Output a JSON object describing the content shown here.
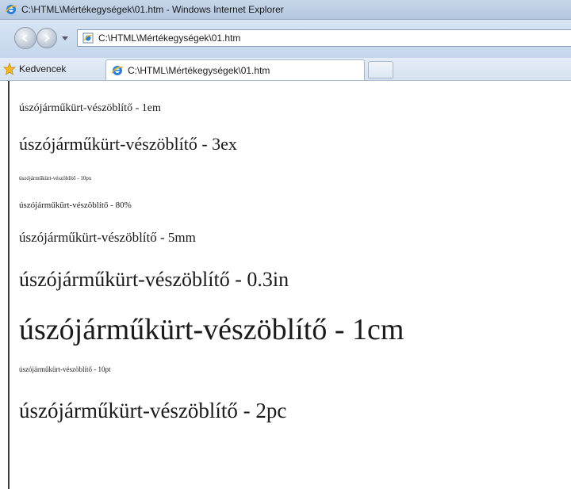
{
  "window": {
    "title": "C:\\HTML\\Mértékegységek\\01.htm - Windows Internet Explorer",
    "icon": "ie-icon"
  },
  "navigation": {
    "address": "C:\\HTML\\Mértékegységek\\01.htm"
  },
  "favorites": {
    "label": "Kedvencek"
  },
  "tab": {
    "label": "C:\\HTML\\Mértékegységek\\01.htm"
  },
  "content": {
    "lines": [
      {
        "text": "úszójárműkürt-vészöblítő - 1em"
      },
      {
        "text": "úszójárműkürt-vészöblítő - 3ex"
      },
      {
        "text": "úszójárműkürt-vészöblítő - 10px"
      },
      {
        "text": "úszójárműkürt-vészöblítő - 80%"
      },
      {
        "text": "úszójárműkürt-vészöblítő - 5mm"
      },
      {
        "text": "úszójárműkürt-vészöblítő - 0.3in"
      },
      {
        "text": "úszójárműkürt-vészöblítő - 1cm"
      },
      {
        "text": "úszójárműkürt-vészöblítő - 10pt"
      },
      {
        "text": "úszójárműkürt-vészöblítő - 2pc"
      }
    ]
  },
  "colors": {
    "titlebar": "#b4c7df",
    "accent_ie": "#1f6fc5",
    "favorites_star": "#f2b824"
  }
}
